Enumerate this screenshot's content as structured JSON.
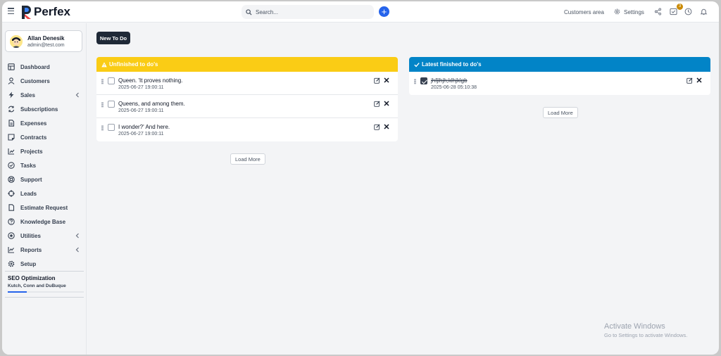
{
  "app": {
    "name": "Perfex"
  },
  "header": {
    "search_placeholder": "Search...",
    "customers_area": "Customers area",
    "settings": "Settings",
    "todo_badge": "3"
  },
  "user": {
    "name": "Allan Denesik",
    "email": "admin@test.com"
  },
  "sidebar": {
    "items": [
      {
        "label": "Dashboard",
        "icon": "home-icon"
      },
      {
        "label": "Customers",
        "icon": "user-icon"
      },
      {
        "label": "Sales",
        "icon": "bolt-icon",
        "submenu": true
      },
      {
        "label": "Subscriptions",
        "icon": "refresh-icon"
      },
      {
        "label": "Expenses",
        "icon": "file-icon"
      },
      {
        "label": "Contracts",
        "icon": "note-icon"
      },
      {
        "label": "Projects",
        "icon": "chart-icon"
      },
      {
        "label": "Tasks",
        "icon": "check-circle-icon"
      },
      {
        "label": "Support",
        "icon": "lifebuoy-icon"
      },
      {
        "label": "Leads",
        "icon": "crosshair-icon"
      },
      {
        "label": "Estimate Request",
        "icon": "document-icon"
      },
      {
        "label": "Knowledge Base",
        "icon": "question-icon"
      },
      {
        "label": "Utilities",
        "icon": "dot-circle-icon",
        "submenu": true
      },
      {
        "label": "Reports",
        "icon": "line-chart-icon",
        "submenu": true
      },
      {
        "label": "Setup",
        "icon": "gear-icon"
      }
    ],
    "project": {
      "title": "SEO Optimization",
      "client": "Kutch, Conn and DuBuque",
      "progress": 0.25
    }
  },
  "main": {
    "new_todo_label": "New To Do",
    "unfinished": {
      "title": "Unfinished to do's",
      "color": "#facc15",
      "items": [
        {
          "title": "Queen. 'It proves nothing.",
          "date": "2025-06-27 19:00:11",
          "done": false
        },
        {
          "title": "Queens, and among them.",
          "date": "2025-06-27 19:00:11",
          "done": false
        },
        {
          "title": "I wonder?' And here.",
          "date": "2025-06-27 19:00:11",
          "done": false
        }
      ],
      "load_more": "Load More"
    },
    "finished": {
      "title": "Latest finished to do's",
      "color": "#0284c7",
      "items": [
        {
          "title": "jhfjlhjh;klhjklgb",
          "date": "2025-06-28 05:10:38",
          "done": true
        }
      ],
      "load_more": "Load More"
    }
  },
  "watermark": {
    "title": "Activate Windows",
    "subtitle": "Go to Settings to activate Windows."
  }
}
